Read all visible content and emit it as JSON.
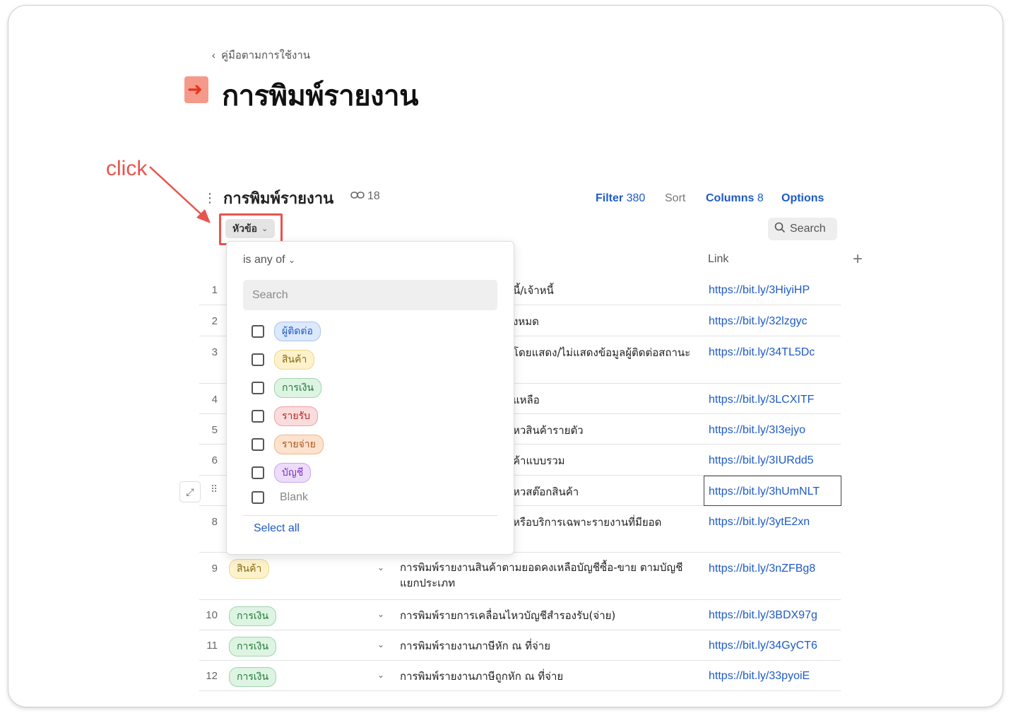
{
  "breadcrumb": {
    "label": "คู่มือตามการใช้งาน"
  },
  "page": {
    "title": "การพิมพ์รายงาน"
  },
  "annotation": {
    "label": "click"
  },
  "table_header": {
    "title": "การพิมพ์รายงาน",
    "link_count": "18",
    "filter_label": "Filter",
    "filter_count": "380",
    "sort_label": "Sort",
    "columns_label": "Columns",
    "columns_count": "8",
    "options_label": "Options",
    "search_label": "Search"
  },
  "filter_chip": {
    "label": "หัวข้อ"
  },
  "columns": {
    "link": "Link"
  },
  "dropdown": {
    "operator": "is any of",
    "search_placeholder": "Search",
    "options": [
      {
        "label": "ผู้ติดต่อ",
        "color": "blue"
      },
      {
        "label": "สินค้า",
        "color": "yellow"
      },
      {
        "label": "การเงิน",
        "color": "green"
      },
      {
        "label": "รายรับ",
        "color": "red"
      },
      {
        "label": "รายจ่าย",
        "color": "orange"
      },
      {
        "label": "บัญชี",
        "color": "purple"
      }
    ],
    "blank_label": "Blank",
    "select_all": "Select all"
  },
  "rows": [
    {
      "num": "1",
      "title_tail": "นี้/เจ้าหนี้",
      "link": "https://bit.ly/3HiyiHP"
    },
    {
      "num": "2",
      "title_tail": "้งหมด",
      "link": "https://bit.ly/32lzgyc"
    },
    {
      "num": "3",
      "title_tail": "โดยแสดง/ไม่แสดงข้อมูลผู้ติดต่อสถานะ",
      "link": "https://bit.ly/34TL5Dc"
    },
    {
      "num": "4",
      "title_tail": "แหลือ",
      "link": "https://bit.ly/3LCXITF"
    },
    {
      "num": "5",
      "title_tail": "หวสินค้ารายตัว",
      "link": "https://bit.ly/3I3ejyo"
    },
    {
      "num": "6",
      "title_tail": "ค้าแบบรวม",
      "link": "https://bit.ly/3IURdd5"
    },
    {
      "num": "7",
      "title_tail": "หวสต๊อกสินค้า",
      "link": "https://bit.ly/3hUmNLT"
    },
    {
      "num": "8",
      "title_tail": "หรือบริการเฉพาะรายงานที่มียอด",
      "link": "https://bit.ly/3ytE2xn"
    },
    {
      "num": "9",
      "tag": "สินค้า",
      "title": "การพิมพ์รายงานสินค้าตามยอดคงเหลือบัญชีซื้อ-ขาย ตามบัญชีแยกประเภท",
      "link": "https://bit.ly/3nZFBg8"
    },
    {
      "num": "10",
      "tag": "การเงิน",
      "title": "การพิมพ์รายการเคลื่อนไหวบัญชีสำรองรับ(จ่าย)",
      "link": "https://bit.ly/3BDX97g"
    },
    {
      "num": "11",
      "tag": "การเงิน",
      "title": "การพิมพ์รายงานภาษีหัก ณ ที่จ่าย",
      "link": "https://bit.ly/34GyCT6"
    },
    {
      "num": "12",
      "tag": "การเงิน",
      "title": "การพิมพ์รายงานภาษีถูกหัก ณ ที่จ่าย",
      "link": "https://bit.ly/33pyoiE"
    }
  ]
}
